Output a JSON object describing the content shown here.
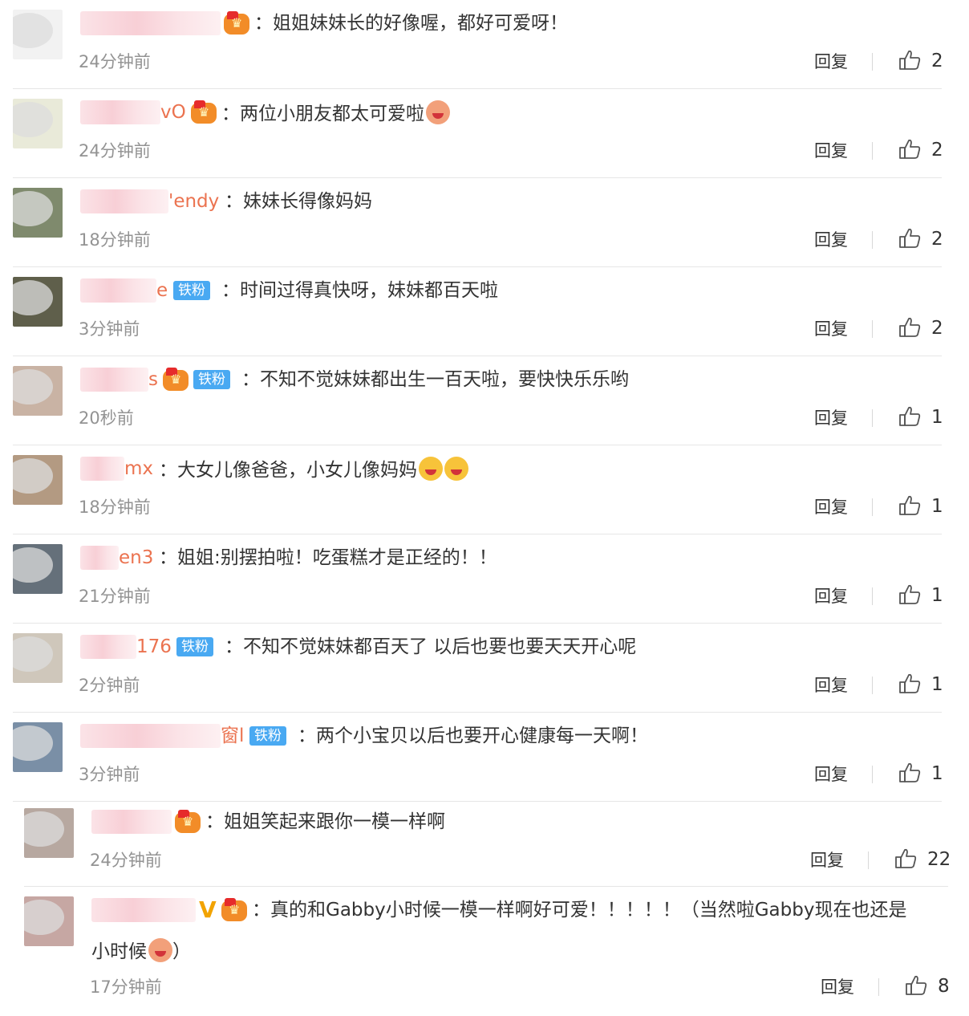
{
  "comments": [
    {
      "name_suffix": "",
      "badges": [
        "crown"
      ],
      "text": "：姐姐妹妹长的好像喔，都好可爱呀！",
      "emojis": [],
      "time": "24分钟前",
      "reply": "回复",
      "likes": "2",
      "avatar_color": "#f2f2f2"
    },
    {
      "name_suffix": "vO",
      "badges": [
        "crown"
      ],
      "text": "：两位小朋友都太可爱啦",
      "emojis": [
        "red"
      ],
      "time": "24分钟前",
      "reply": "回复",
      "likes": "2",
      "avatar_color": "#e9ead9"
    },
    {
      "name_suffix": "'endy",
      "badges": [],
      "text": "：妹妹长得像妈妈",
      "emojis": [],
      "time": "18分钟前",
      "reply": "回复",
      "likes": "2",
      "avatar_color": "#7f8a6d"
    },
    {
      "name_suffix": "e",
      "badges": [
        "fan"
      ],
      "text": "：时间过得真快呀，妹妹都百天啦",
      "emojis": [],
      "time": "3分钟前",
      "reply": "回复",
      "likes": "2",
      "avatar_color": "#5f5f4b"
    },
    {
      "name_suffix": "s",
      "badges": [
        "crown",
        "fan"
      ],
      "text": "：不知不觉妹妹都出生一百天啦，要快快乐乐哟",
      "emojis": [],
      "time": "20秒前",
      "reply": "回复",
      "likes": "1",
      "avatar_color": "#c9b3a4"
    },
    {
      "name_suffix": "mx",
      "badges": [],
      "text": "：大女儿像爸爸，小女儿像妈妈",
      "emojis": [
        "yellow",
        "yellow"
      ],
      "time": "18分钟前",
      "reply": "回复",
      "likes": "1",
      "avatar_color": "#b39a82"
    },
    {
      "name_suffix": "en3",
      "badges": [],
      "text": "：姐姐:别摆拍啦！吃蛋糕才是正经的！！",
      "emojis": [],
      "time": "21分钟前",
      "reply": "回复",
      "likes": "1",
      "avatar_color": "#65707a"
    },
    {
      "name_suffix": "176",
      "badges": [
        "fan"
      ],
      "text": "：不知不觉妹妹都百天了 以后也要也要天天开心呢",
      "emojis": [],
      "time": "2分钟前",
      "reply": "回复",
      "likes": "1",
      "avatar_color": "#cfc7bb"
    },
    {
      "name_suffix": "窗l",
      "badges": [
        "fan"
      ],
      "text": "：两个小宝贝以后也要开心健康每一天啊！",
      "emojis": [],
      "time": "3分钟前",
      "reply": "回复",
      "likes": "1",
      "avatar_color": "#7a8fa6"
    },
    {
      "name_suffix": "",
      "badges": [
        "crown"
      ],
      "text": "：姐姐笑起来跟你一模一样啊",
      "emojis": [],
      "time": "24分钟前",
      "reply": "回复",
      "likes": "22",
      "avatar_color": "#b7a8a0"
    },
    {
      "name_suffix": "",
      "badges": [
        "v",
        "crown"
      ],
      "text": "：真的和Gabby小时候一模一样啊好可爱！！！！！（当然啦Gabby现在也还是",
      "text2": "小时候",
      "text2_end": "）",
      "emojis": [],
      "time": "17分钟前",
      "reply": "回复",
      "likes": "8",
      "avatar_color": "#c6a7a3"
    }
  ],
  "fan_label": "铁粉",
  "v_label": "V"
}
